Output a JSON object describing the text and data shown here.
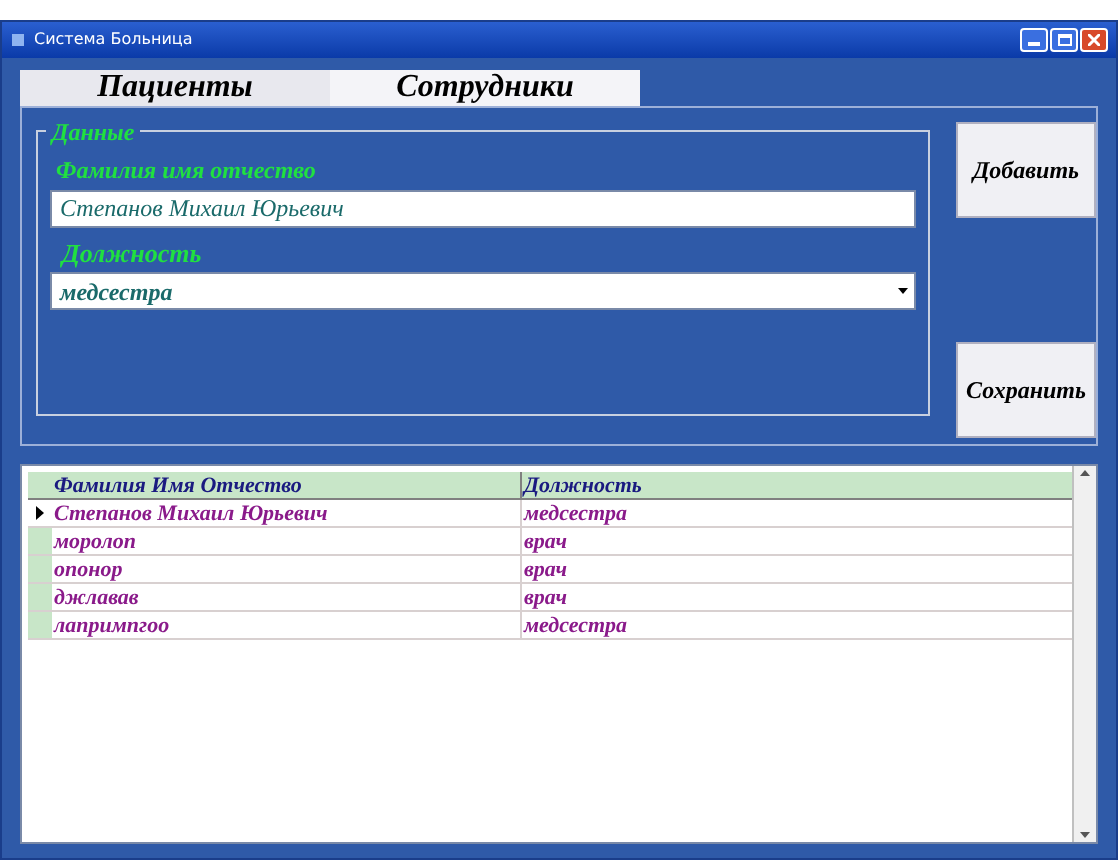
{
  "window": {
    "title": "Система Больница"
  },
  "tabs": [
    {
      "label": "Пациенты",
      "selected": false
    },
    {
      "label": "Сотрудники",
      "selected": true
    }
  ],
  "group": {
    "title": "Данные",
    "name_field": {
      "label": "Фамилия имя отчество",
      "value": "Степанов Михаил Юрьевич"
    },
    "position_field": {
      "label": "Должность",
      "value": "медсестра"
    }
  },
  "buttons": [
    "Добавить",
    "Сохранить"
  ],
  "table": {
    "columns": [
      "Фамилия Имя Отчество",
      "Должность"
    ],
    "rows": [
      {
        "cells": [
          "Степанов Михаил Юрьевич",
          "медсестра"
        ],
        "selected": true
      },
      {
        "cells": [
          "моролоп",
          "врач"
        ],
        "selected": false
      },
      {
        "cells": [
          "опонор",
          "врач"
        ],
        "selected": false
      },
      {
        "cells": [
          "джлавав",
          "врач"
        ],
        "selected": false
      },
      {
        "cells": [
          "лапримпгоо",
          "медсестра"
        ],
        "selected": false
      }
    ]
  }
}
